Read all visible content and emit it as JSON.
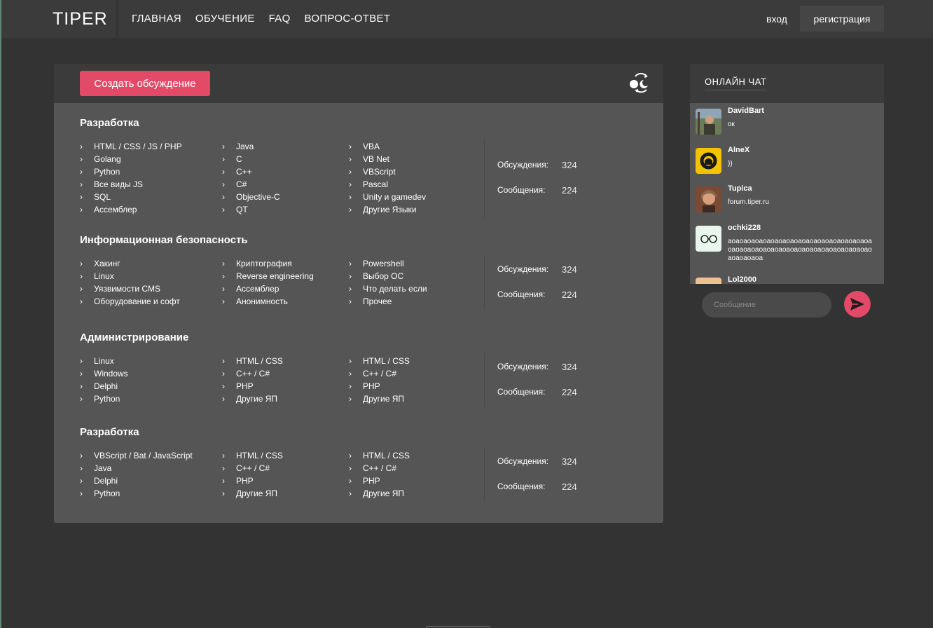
{
  "header": {
    "logo": "TIPER",
    "nav": [
      "ГЛАВНАЯ",
      "ОБУЧЕНИЕ",
      "FAQ",
      "ВОПРОС-ОТВЕТ"
    ],
    "login": "вход",
    "register": "регистрация"
  },
  "forum": {
    "create_button": "Создать обсуждение",
    "theme_icon": "day-night-toggle-icon",
    "stat_labels": {
      "discussions": "Обсуждения:",
      "messages": "Сообщения:"
    },
    "sections": [
      {
        "title": "Разработка",
        "columns": [
          [
            "HTML / CSS / JS / PHP",
            "Golang",
            "Python",
            "Все виды JS",
            "SQL",
            "Ассемблер"
          ],
          [
            "Java",
            "C",
            "C++",
            "C#",
            "Objective-C",
            "QT"
          ],
          [
            "VBA",
            "VB Net",
            "VBScript",
            "Pascal",
            "Unity и gamedev",
            "Другие Языки"
          ]
        ],
        "discussions": "324",
        "messages": "224"
      },
      {
        "title": "Информационная безопасность",
        "columns": [
          [
            "Хакинг",
            "Linux",
            "Уязвимости  CMS",
            "Оборудование и софт"
          ],
          [
            "Криптография",
            "Reverse engineering",
            "Ассемблер",
            "Анонимность"
          ],
          [
            "Powershell",
            "Выбор ОС",
            "Что делать если",
            "Прочее"
          ]
        ],
        "discussions": "324",
        "messages": "224"
      },
      {
        "title": "Администрирование",
        "columns": [
          [
            "Linux",
            "Windows",
            "Delphi",
            "Python"
          ],
          [
            "HTML / CSS",
            "C++ / C#",
            "PHP",
            "Другие ЯП"
          ],
          [
            "HTML / CSS",
            "C++ / C#",
            "PHP",
            "Другие ЯП"
          ]
        ],
        "discussions": "324",
        "messages": "224"
      },
      {
        "title": "Разработка",
        "columns": [
          [
            "VBScript / Bat / JavaScript",
            "Java",
            "Delphi",
            "Python"
          ],
          [
            "HTML / CSS",
            "C++ / C#",
            "PHP",
            "Другие ЯП"
          ],
          [
            "HTML / CSS",
            "C++ / C#",
            "PHP",
            "Другие ЯП"
          ]
        ],
        "discussions": "324",
        "messages": "224"
      }
    ]
  },
  "chat": {
    "title": "ОНЛАЙН ЧАТ",
    "messages": [
      {
        "user": "DavidBart",
        "text": "ок",
        "avatar": "photo-avatar"
      },
      {
        "user": "AlneX",
        "text": "))",
        "avatar": "yellow-emblem-avatar"
      },
      {
        "user": "Tupica",
        "text": "forum.tiper.ru",
        "avatar": "photo-avatar"
      },
      {
        "user": "ochki228",
        "text": "аоаоаоаоаоаоаоаоаоаоаоаоаоаоаоаоаоаоаоаоаоаоаоаоаоаоаоаоаоаоаоаоаоаоаоаоаоаоаоаоаоа",
        "avatar": "glasses-avatar"
      },
      {
        "user": "Lol2000",
        "text": "",
        "avatar": "peach-avatar"
      }
    ],
    "input_placeholder": "Сообщение",
    "send_icon": "send-arrow-icon"
  },
  "colors": {
    "accent": "#e34a68",
    "background": "#333333",
    "panel": "#555555",
    "header": "#3b3b3b"
  }
}
